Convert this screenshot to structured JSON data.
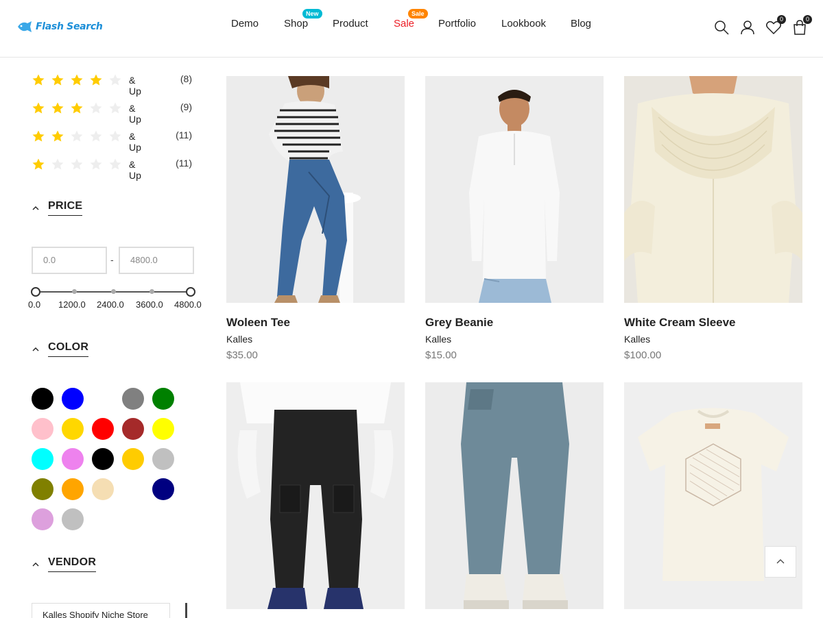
{
  "header": {
    "logo_text": "Flash Search",
    "nav": [
      {
        "label": "Demo",
        "badge": ""
      },
      {
        "label": "Shop",
        "badge": "New"
      },
      {
        "label": "Product",
        "badge": ""
      },
      {
        "label": "Sale",
        "badge": "Sale"
      },
      {
        "label": "Portfolio",
        "badge": ""
      },
      {
        "label": "Lookbook",
        "badge": ""
      },
      {
        "label": "Blog",
        "badge": ""
      }
    ],
    "wishlist_count": "0",
    "cart_count": "0"
  },
  "sidebar": {
    "rating": {
      "rows": [
        {
          "stars": 4,
          "label": "& Up",
          "count": "(8)"
        },
        {
          "stars": 3,
          "label": "& Up",
          "count": "(9)"
        },
        {
          "stars": 2,
          "label": "& Up",
          "count": "(11)"
        },
        {
          "stars": 1,
          "label": "& Up",
          "count": "(11)"
        }
      ]
    },
    "price": {
      "title": "PRICE",
      "min_placeholder": "0.0",
      "max_placeholder": "4800.0",
      "separator": "-",
      "scale": [
        "0.0",
        "1200.0",
        "2400.0",
        "3600.0",
        "4800.0"
      ]
    },
    "color": {
      "title": "COLOR",
      "swatches": [
        "#000000",
        "#0000ff",
        "#ffffff",
        "#808080",
        "#008000",
        "#ffc0cb",
        "#ffd700",
        "#ff0000",
        "#a52a2a",
        "#ffff00",
        "#00ffff",
        "#ee82ee",
        "#000000",
        "#ffcc00",
        "#c0c0c0",
        "#808000",
        "#ffa500",
        "#f5deb3",
        "#ffffff",
        "#000080",
        "#dda0dd",
        "#c0c0c0"
      ]
    },
    "vendor": {
      "title": "VENDOR",
      "option": "Kalles Shopify Niche Store"
    }
  },
  "products": [
    {
      "title": "Woleen Tee",
      "vendor": "Kalles",
      "price": "$35.00"
    },
    {
      "title": "Grey Beanie",
      "vendor": "Kalles",
      "price": "$15.00"
    },
    {
      "title": "White Cream Sleeve",
      "vendor": "Kalles",
      "price": "$100.00"
    },
    {
      "title": "",
      "vendor": "",
      "price": ""
    },
    {
      "title": "",
      "vendor": "",
      "price": ""
    },
    {
      "title": "",
      "vendor": "",
      "price": ""
    }
  ],
  "colors": {
    "accent": "#ec1c24",
    "badge_new": "#01bad4",
    "badge_sale": "#ff8400",
    "star": "#ffcc00",
    "star_empty": "#eeeeee",
    "logo": "#1d8fd8"
  }
}
